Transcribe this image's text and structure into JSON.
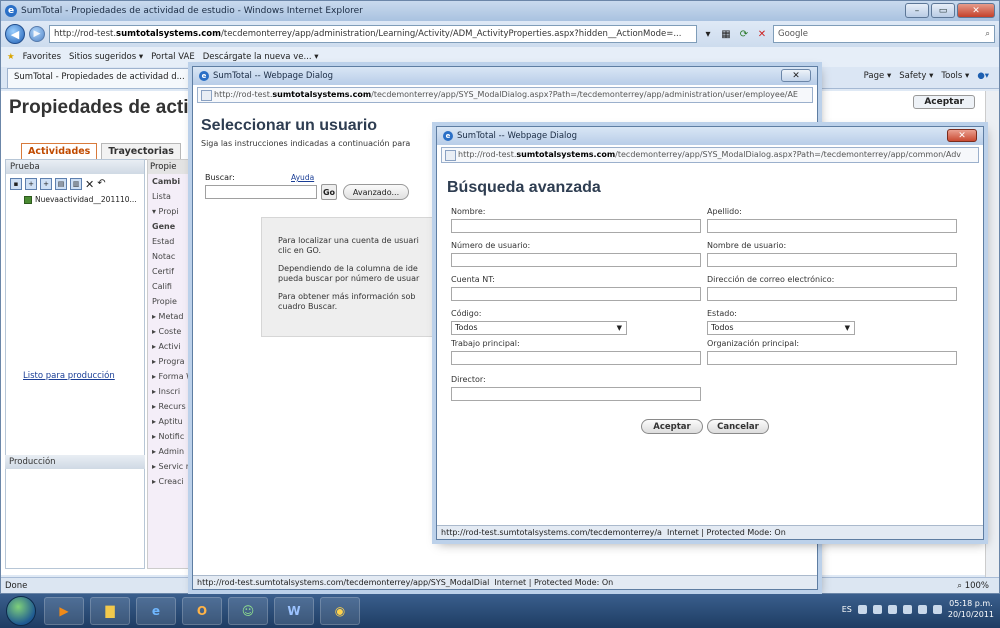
{
  "ie": {
    "title": "SumTotal - Propiedades de actividad de estudio - Windows Internet Explorer",
    "url_prefix": "http://rod-test.",
    "url_host": "sumtotalsystems.com",
    "url_rest": "/tecdemonterrey/app/administration/Learning/Activity/ADM_ActivityProperties.aspx?hidden__ActionMode=...",
    "search_placeholder": "Google",
    "favorites_label": "Favorites",
    "fav_items": [
      "Sitios sugeridos ▾",
      "Portal VAE",
      "Descárgate la nueva ve... ▾"
    ],
    "tab_label": "SumTotal - Propiedades de actividad d...",
    "cmd_items": [
      "Page ▾",
      "Safety ▾",
      "Tools ▾"
    ],
    "status_text": "Done",
    "zoom": "100%"
  },
  "page": {
    "title": "Propiedades de acti",
    "accept_label": "Aceptar",
    "tabs": [
      "Actividades",
      "Trayectorias"
    ],
    "left_pane_head": "Prueba",
    "tree_item": "Nuevaactividad__201110...",
    "list_link": "Listo para producción",
    "production_head": "Producción",
    "mid_head": "Propie",
    "mid_items": [
      "Cambi",
      "Lista",
      "▾ Propi",
      "Gene",
      "Estad",
      "Notac",
      "Certif",
      "Califi",
      "Propie",
      "▸ Metad",
      "▸ Coste",
      "▸ Activi",
      "▸ Progra",
      "▸ Forma Web",
      "▸ Inscri",
      "▸ Recurs",
      "▸ Aptitu",
      "▸ Notific",
      "▸ Admin",
      "▸ Servic remoto",
      "▸ Creaci"
    ]
  },
  "dialog1": {
    "title": "SumTotal -- Webpage Dialog",
    "url_prefix": "http://rod-test.",
    "url_host": "sumtotalsystems.com",
    "url_rest": "/tecdemonterrey/app/SYS_ModalDialog.aspx?Path=/tecdemonterrey/app/administration/user/employee/AE",
    "heading": "Seleccionar un usuario",
    "subtitle": "Siga las instrucciones indicadas a continuación para",
    "search_label": "Buscar:",
    "help_link": "Ayuda",
    "go_label": "Go",
    "advanced_label": "Avanzado...",
    "info_lines": [
      "Para localizar una cuenta de usuari",
      "clic en GO.",
      "Dependiendo de la columna de ide",
      "pueda buscar por número de usuar",
      "Para obtener más información sob",
      "cuadro Buscar."
    ],
    "status": "http://rod-test.sumtotalsystems.com/tecdemonterrey/app/SYS_ModalDial  Internet | Protected Mode: On"
  },
  "dialog2": {
    "title": "SumTotal -- Webpage Dialog",
    "url_prefix": "http://rod-test.",
    "url_host": "sumtotalsystems.com",
    "url_rest": "/tecdemonterrey/app/SYS_ModalDialog.aspx?Path=/tecdemonterrey/app/common/Adv",
    "heading": "Búsqueda avanzada",
    "labels": {
      "nombre": "Nombre:",
      "apellido": "Apellido:",
      "numero_usuario": "Número de usuario:",
      "nombre_usuario": "Nombre de usuario:",
      "cuenta_nt": "Cuenta NT:",
      "correo": "Dirección de correo electrónico:",
      "codigo": "Código:",
      "estado": "Estado:",
      "trabajo": "Trabajo principal:",
      "organizacion": "Organización principal:",
      "director": "Director:"
    },
    "codigo_value": "Todos",
    "estado_value": "Todos",
    "accept_label": "Aceptar",
    "cancel_label": "Cancelar",
    "status": "http://rod-test.sumtotalsystems.com/tecdemonterrey/a  Internet | Protected Mode: On"
  },
  "taskbar": {
    "lang": "ES",
    "time": "05:18 p.m.",
    "date": "20/10/2011"
  }
}
